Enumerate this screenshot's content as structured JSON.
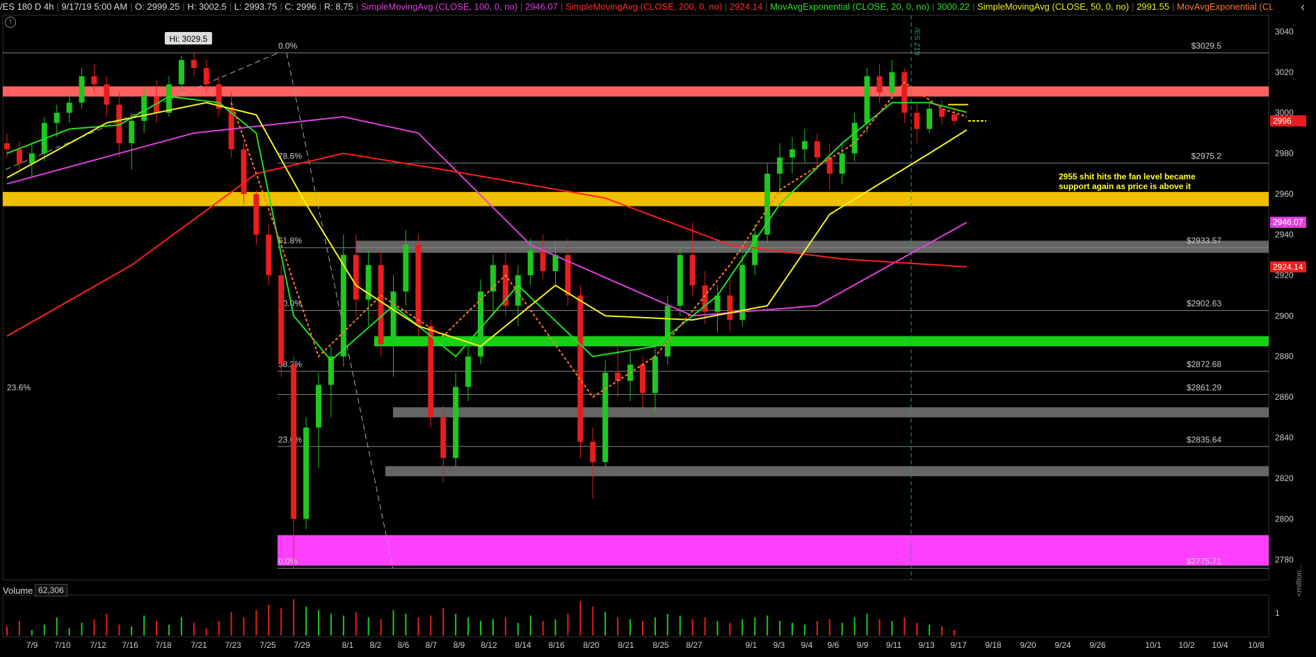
{
  "header": {
    "symbol": "/ES 180 D 4h",
    "datetime": "9/17/19 5:00 AM",
    "open": "O: 2999.25",
    "high": "H: 3002.5",
    "low": "L: 2993.75",
    "close": "C: 2996",
    "range": "R: 8.75",
    "studies": [
      {
        "label": "SimpleMovingAvg (CLOSE, 100, 0, no)",
        "value": "2946.07",
        "color": "#e040e0"
      },
      {
        "label": "SimpleMovingAvg (CLOSE, 200, 0, no)",
        "value": "2924.14",
        "color": "#ff3030"
      },
      {
        "label": "MovAvgExponential (CLOSE, 20, 0, no)",
        "value": "3000.22",
        "color": "#30e030"
      },
      {
        "label": "SimpleMovingAvg (CLOSE, 50, 0, no)",
        "value": "2991.55",
        "color": "#f0f020"
      },
      {
        "label": "MovAvgExponential (CLOSE...",
        "value": "",
        "color": "#ff7a30"
      }
    ]
  },
  "colors": {
    "up": "#1ec81e",
    "down": "#e81e1e",
    "sma100": "#e040e0",
    "sma200": "#ff2020",
    "ema20": "#22e022",
    "sma50": "#f5f520",
    "ema_fast": "#ff7a30",
    "zone_red": "#ff6060",
    "zone_gold": "#f0c000",
    "zone_grey": "#777777",
    "zone_green": "#18d018",
    "zone_pink": "#ff40ff"
  },
  "chart_data": {
    "type": "candlestick",
    "ylim": [
      2770,
      3048
    ],
    "y_ticks": [
      2780,
      2800,
      2820,
      2840,
      2860,
      2880,
      2900,
      2920,
      2940,
      2960,
      2980,
      3000,
      3020,
      3040
    ],
    "x_labels": [
      "7/9",
      "7/10",
      "7/12",
      "7/16",
      "7/18",
      "7/21",
      "7/23",
      "7/25",
      "7/29",
      "8/1",
      "8/2",
      "8/6",
      "8/7",
      "8/9",
      "8/12",
      "8/14",
      "8/16",
      "8/20",
      "8/21",
      "8/25",
      "8/27",
      "9/1",
      "9/3",
      "9/4",
      "9/6",
      "9/9",
      "9/11",
      "9/13",
      "9/17",
      "9/18",
      "9/20",
      "9/24",
      "9/26",
      "10/1",
      "10/2",
      "10/4",
      "10/8"
    ],
    "price_badges": [
      {
        "value": 2996,
        "label": "2996",
        "color": "#e81e1e"
      },
      {
        "value": 2946.07,
        "label": "2946.07",
        "color": "#e040e0"
      },
      {
        "value": 2924.14,
        "label": "2924.14",
        "color": "#e81e1e"
      }
    ],
    "hi_label": "Hi: 3029.5",
    "fib_levels": [
      {
        "pct": "0.0%",
        "price": 3029.5,
        "label": "$3029.5"
      },
      {
        "pct": "78.6%",
        "price": 2975.2,
        "label": "$2975.2"
      },
      {
        "pct": "61.8%",
        "price": 2933.57,
        "label": "$2933.57"
      },
      {
        "pct": "50.0%",
        "price": 2902.63,
        "label": "$2902.63"
      },
      {
        "pct": "38.2%",
        "price": 2872.68,
        "label": "$2872.68"
      },
      {
        "pct": "23.6%",
        "price": 2861.29,
        "label": "$2861.29"
      },
      {
        "pct": "23.6%",
        "price": 2835.64,
        "label": "$2835.64"
      },
      {
        "pct": "0.0%",
        "price": 2775.71,
        "label": "$2775.71"
      }
    ],
    "zones": [
      {
        "name": "red",
        "from": 3008,
        "to": 3013
      },
      {
        "name": "gold",
        "from": 2954,
        "to": 2961
      },
      {
        "name": "grey",
        "from": 2931,
        "to": 2937
      },
      {
        "name": "green",
        "from": 2885,
        "to": 2890
      },
      {
        "name": "grey",
        "from": 2850,
        "to": 2855
      },
      {
        "name": "grey",
        "from": 2821,
        "to": 2826
      },
      {
        "name": "pink",
        "from": 2777,
        "to": 2792
      }
    ],
    "annotation": [
      "2955 shit hits the fan level became",
      "support again as price is above it"
    ],
    "vertical_marker_label": "/ES Z19",
    "ohlc": [
      {
        "o": 2985,
        "h": 2990,
        "l": 2978,
        "c": 2982
      },
      {
        "o": 2982,
        "h": 2986,
        "l": 2972,
        "c": 2975
      },
      {
        "o": 2975,
        "h": 2985,
        "l": 2968,
        "c": 2980
      },
      {
        "o": 2980,
        "h": 2998,
        "l": 2976,
        "c": 2995
      },
      {
        "o": 2995,
        "h": 3004,
        "l": 2988,
        "c": 3000
      },
      {
        "o": 3000,
        "h": 3010,
        "l": 2995,
        "c": 3005
      },
      {
        "o": 3005,
        "h": 3022,
        "l": 3002,
        "c": 3018
      },
      {
        "o": 3018,
        "h": 3024,
        "l": 3010,
        "c": 3014
      },
      {
        "o": 3014,
        "h": 3018,
        "l": 2998,
        "c": 3004
      },
      {
        "o": 3004,
        "h": 3010,
        "l": 2978,
        "c": 2985
      },
      {
        "o": 2985,
        "h": 3000,
        "l": 2972,
        "c": 2996
      },
      {
        "o": 2996,
        "h": 3012,
        "l": 2990,
        "c": 3008
      },
      {
        "o": 3008,
        "h": 3016,
        "l": 2995,
        "c": 3000
      },
      {
        "o": 3000,
        "h": 3018,
        "l": 2998,
        "c": 3014
      },
      {
        "o": 3014,
        "h": 3028,
        "l": 3010,
        "c": 3026
      },
      {
        "o": 3026,
        "h": 3030,
        "l": 3018,
        "c": 3022
      },
      {
        "o": 3022,
        "h": 3026,
        "l": 3010,
        "c": 3014
      },
      {
        "o": 3014,
        "h": 3018,
        "l": 2998,
        "c": 3002
      },
      {
        "o": 3002,
        "h": 3010,
        "l": 2978,
        "c": 2982
      },
      {
        "o": 2982,
        "h": 2985,
        "l": 2955,
        "c": 2960
      },
      {
        "o": 2960,
        "h": 2962,
        "l": 2935,
        "c": 2940
      },
      {
        "o": 2940,
        "h": 2945,
        "l": 2915,
        "c": 2920
      },
      {
        "o": 2920,
        "h": 2925,
        "l": 2870,
        "c": 2876
      },
      {
        "o": 2876,
        "h": 2880,
        "l": 2776,
        "c": 2800
      },
      {
        "o": 2800,
        "h": 2850,
        "l": 2795,
        "c": 2845
      },
      {
        "o": 2845,
        "h": 2872,
        "l": 2825,
        "c": 2866
      },
      {
        "o": 2866,
        "h": 2885,
        "l": 2850,
        "c": 2880
      },
      {
        "o": 2880,
        "h": 2940,
        "l": 2875,
        "c": 2930
      },
      {
        "o": 2930,
        "h": 2940,
        "l": 2900,
        "c": 2908
      },
      {
        "o": 2908,
        "h": 2932,
        "l": 2895,
        "c": 2925
      },
      {
        "o": 2925,
        "h": 2932,
        "l": 2880,
        "c": 2886
      },
      {
        "o": 2886,
        "h": 2920,
        "l": 2870,
        "c": 2912
      },
      {
        "o": 2912,
        "h": 2942,
        "l": 2905,
        "c": 2935
      },
      {
        "o": 2935,
        "h": 2940,
        "l": 2890,
        "c": 2895
      },
      {
        "o": 2895,
        "h": 2898,
        "l": 2845,
        "c": 2850
      },
      {
        "o": 2850,
        "h": 2856,
        "l": 2818,
        "c": 2830
      },
      {
        "o": 2830,
        "h": 2872,
        "l": 2826,
        "c": 2865
      },
      {
        "o": 2865,
        "h": 2885,
        "l": 2858,
        "c": 2880
      },
      {
        "o": 2880,
        "h": 2918,
        "l": 2876,
        "c": 2912
      },
      {
        "o": 2912,
        "h": 2930,
        "l": 2900,
        "c": 2925
      },
      {
        "o": 2925,
        "h": 2932,
        "l": 2900,
        "c": 2905
      },
      {
        "o": 2905,
        "h": 2925,
        "l": 2895,
        "c": 2920
      },
      {
        "o": 2920,
        "h": 2938,
        "l": 2915,
        "c": 2932
      },
      {
        "o": 2932,
        "h": 2940,
        "l": 2918,
        "c": 2922
      },
      {
        "o": 2922,
        "h": 2936,
        "l": 2915,
        "c": 2930
      },
      {
        "o": 2930,
        "h": 2938,
        "l": 2905,
        "c": 2910
      },
      {
        "o": 2910,
        "h": 2915,
        "l": 2830,
        "c": 2838
      },
      {
        "o": 2838,
        "h": 2845,
        "l": 2810,
        "c": 2828
      },
      {
        "o": 2828,
        "h": 2878,
        "l": 2825,
        "c": 2872
      },
      {
        "o": 2872,
        "h": 2885,
        "l": 2860,
        "c": 2868
      },
      {
        "o": 2868,
        "h": 2882,
        "l": 2858,
        "c": 2876
      },
      {
        "o": 2876,
        "h": 2880,
        "l": 2855,
        "c": 2862
      },
      {
        "o": 2862,
        "h": 2884,
        "l": 2852,
        "c": 2880
      },
      {
        "o": 2880,
        "h": 2910,
        "l": 2876,
        "c": 2905
      },
      {
        "o": 2905,
        "h": 2935,
        "l": 2900,
        "c": 2930
      },
      {
        "o": 2930,
        "h": 2946,
        "l": 2910,
        "c": 2915
      },
      {
        "o": 2915,
        "h": 2922,
        "l": 2896,
        "c": 2902
      },
      {
        "o": 2902,
        "h": 2915,
        "l": 2892,
        "c": 2910
      },
      {
        "o": 2910,
        "h": 2918,
        "l": 2892,
        "c": 2898
      },
      {
        "o": 2898,
        "h": 2930,
        "l": 2895,
        "c": 2925
      },
      {
        "o": 2925,
        "h": 2945,
        "l": 2920,
        "c": 2940
      },
      {
        "o": 2940,
        "h": 2975,
        "l": 2936,
        "c": 2970
      },
      {
        "o": 2970,
        "h": 2985,
        "l": 2960,
        "c": 2978
      },
      {
        "o": 2978,
        "h": 2988,
        "l": 2970,
        "c": 2982
      },
      {
        "o": 2982,
        "h": 2992,
        "l": 2975,
        "c": 2986
      },
      {
        "o": 2986,
        "h": 2990,
        "l": 2972,
        "c": 2978
      },
      {
        "o": 2978,
        "h": 2985,
        "l": 2962,
        "c": 2970
      },
      {
        "o": 2970,
        "h": 2985,
        "l": 2965,
        "c": 2980
      },
      {
        "o": 2980,
        "h": 3000,
        "l": 2976,
        "c": 2995
      },
      {
        "o": 2995,
        "h": 3022,
        "l": 2990,
        "c": 3018
      },
      {
        "o": 3018,
        "h": 3024,
        "l": 3005,
        "c": 3010
      },
      {
        "o": 3010,
        "h": 3026,
        "l": 3008,
        "c": 3020
      },
      {
        "o": 3020,
        "h": 3022,
        "l": 2995,
        "c": 3000
      },
      {
        "o": 3000,
        "h": 3005,
        "l": 2985,
        "c": 2992
      },
      {
        "o": 2992,
        "h": 3006,
        "l": 2990,
        "c": 3002
      },
      {
        "o": 3002,
        "h": 3006,
        "l": 2994,
        "c": 2998
      },
      {
        "o": 2999.25,
        "h": 3002.5,
        "l": 2993.75,
        "c": 2996
      }
    ],
    "series": [
      {
        "name": "SimpleMovingAvg (CLOSE, 100, 0, no)",
        "color_key": "sma100",
        "values": [
          [
            0,
            2965
          ],
          [
            15,
            2990
          ],
          [
            27,
            2998
          ],
          [
            33,
            2990
          ],
          [
            42,
            2935
          ],
          [
            55,
            2900
          ],
          [
            65,
            2905
          ],
          [
            77,
            2946.07
          ]
        ]
      },
      {
        "name": "SimpleMovingAvg (CLOSE, 200, 0, no)",
        "color_key": "sma200",
        "values": [
          [
            0,
            2890
          ],
          [
            10,
            2925
          ],
          [
            20,
            2970
          ],
          [
            27,
            2980
          ],
          [
            35,
            2972
          ],
          [
            48,
            2958
          ],
          [
            58,
            2935
          ],
          [
            67,
            2928
          ],
          [
            77,
            2924.14
          ]
        ]
      },
      {
        "name": "MovAvgExponential (CLOSE, 20, 0, no)",
        "color_key": "ema20",
        "values": [
          [
            0,
            2980
          ],
          [
            5,
            2992
          ],
          [
            9,
            2994
          ],
          [
            13,
            3008
          ],
          [
            17,
            3005
          ],
          [
            20,
            2990
          ],
          [
            23,
            2900
          ],
          [
            26,
            2878
          ],
          [
            31,
            2905
          ],
          [
            36,
            2880
          ],
          [
            41,
            2915
          ],
          [
            47,
            2880
          ],
          [
            52,
            2885
          ],
          [
            57,
            2910
          ],
          [
            62,
            2955
          ],
          [
            67,
            2985
          ],
          [
            71,
            3005
          ],
          [
            74,
            3005
          ],
          [
            77,
            3000.22
          ]
        ]
      },
      {
        "name": "SimpleMovingAvg (CLOSE, 50, 0, no)",
        "color_key": "sma50",
        "values": [
          [
            0,
            2968
          ],
          [
            8,
            2995
          ],
          [
            16,
            3005
          ],
          [
            20,
            2999
          ],
          [
            24,
            2955
          ],
          [
            28,
            2915
          ],
          [
            33,
            2895
          ],
          [
            38,
            2885
          ],
          [
            44,
            2915
          ],
          [
            48,
            2900
          ],
          [
            55,
            2898
          ],
          [
            61,
            2905
          ],
          [
            66,
            2950
          ],
          [
            70,
            2965
          ],
          [
            74,
            2980
          ],
          [
            77,
            2991.55
          ]
        ]
      },
      {
        "name": "MovAvgExponential (CLOSE...",
        "color_key": "ema_fast",
        "values": [
          [
            18,
            3005
          ],
          [
            22,
            2935
          ],
          [
            25,
            2880
          ],
          [
            30,
            2910
          ],
          [
            35,
            2890
          ],
          [
            40,
            2920
          ],
          [
            47,
            2860
          ],
          [
            52,
            2880
          ],
          [
            58,
            2925
          ],
          [
            62,
            2962
          ],
          [
            68,
            2985
          ],
          [
            72,
            3015
          ],
          [
            75,
            3002
          ],
          [
            77,
            2998
          ]
        ]
      }
    ]
  },
  "volume": {
    "label": "Volume",
    "value": "62,306",
    "axis_tick": "1",
    "unit": "<million...",
    "bars": [
      0.25,
      0.4,
      0.15,
      0.3,
      0.5,
      0.2,
      0.35,
      0.45,
      0.6,
      0.3,
      0.25,
      0.55,
      0.4,
      0.3,
      0.5,
      0.35,
      0.2,
      0.4,
      0.65,
      0.5,
      0.7,
      0.85,
      0.75,
      1.0,
      0.8,
      0.7,
      0.6,
      0.55,
      0.65,
      0.5,
      0.45,
      0.7,
      0.6,
      0.5,
      0.55,
      0.75,
      0.6,
      0.5,
      0.4,
      0.45,
      0.5,
      0.35,
      0.55,
      0.4,
      0.45,
      0.6,
      0.95,
      0.8,
      0.65,
      0.5,
      0.45,
      0.4,
      0.5,
      0.6,
      0.55,
      0.45,
      0.5,
      0.4,
      0.35,
      0.45,
      0.5,
      0.55,
      0.4,
      0.35,
      0.3,
      0.4,
      0.45,
      0.35,
      0.5,
      0.6,
      0.45,
      0.4,
      0.5,
      0.35,
      0.3,
      0.25,
      0.15
    ]
  }
}
